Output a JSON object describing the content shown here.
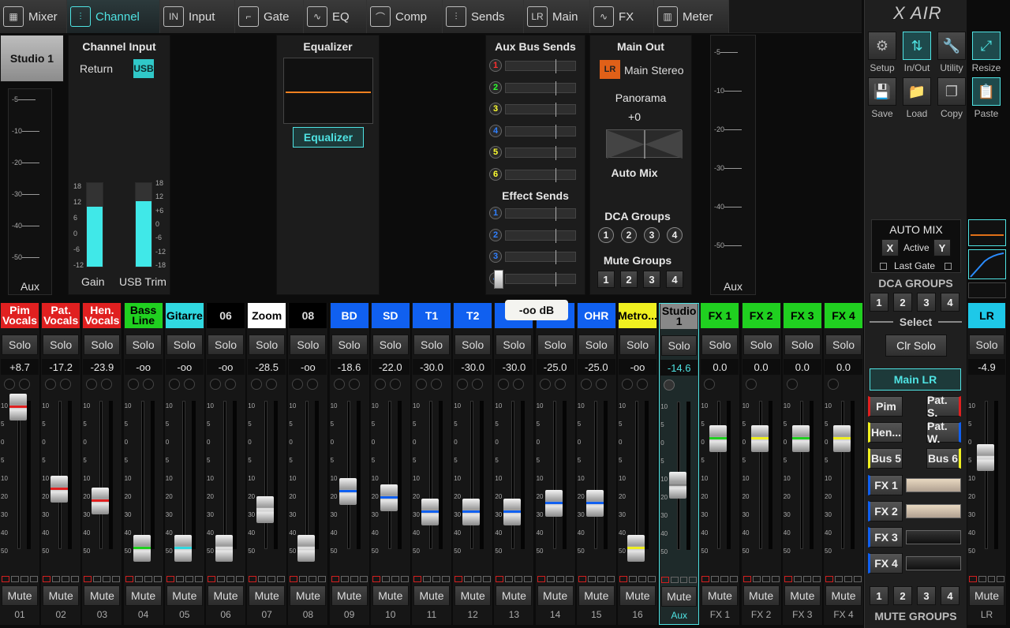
{
  "tabs": [
    {
      "label": "Mixer",
      "icon": "mixer-icon",
      "glyph": "▦",
      "active": false,
      "w": 85
    },
    {
      "label": "Channel",
      "icon": "channel-icon",
      "glyph": "⫶",
      "active": true,
      "w": 118
    },
    {
      "label": "Input",
      "icon": "input-icon",
      "glyph": "IN",
      "active": false,
      "w": 95
    },
    {
      "label": "Gate",
      "icon": "gate-icon",
      "glyph": "⌐",
      "active": false,
      "w": 87
    },
    {
      "label": "EQ",
      "icon": "eq-icon",
      "glyph": "∿",
      "active": false,
      "w": 80
    },
    {
      "label": "Comp",
      "icon": "comp-icon",
      "glyph": "⌒",
      "active": false,
      "w": 96
    },
    {
      "label": "Sends",
      "icon": "sends-icon",
      "glyph": "⫶",
      "active": false,
      "w": 103
    },
    {
      "label": "Main",
      "icon": "main-icon",
      "glyph": "LR",
      "active": false,
      "w": 84
    },
    {
      "label": "FX",
      "icon": "fx-icon",
      "glyph": "∿",
      "active": false,
      "w": 81
    },
    {
      "label": "Meter",
      "icon": "meter-icon",
      "glyph": "▥",
      "active": false,
      "w": 95
    }
  ],
  "channel_name": "Studio 1",
  "aux_meter_label": "Aux",
  "channel_input": {
    "title": "Channel Input",
    "return_label": "Return",
    "usb_label": "USB",
    "gain_label": "Gain",
    "usb_trim_label": "USB Trim",
    "gain_scale": [
      "18",
      "12",
      "6",
      "0",
      "-6",
      "-12"
    ],
    "trim_scale": [
      "18",
      "12",
      "+6",
      "0",
      "-6",
      "-12",
      "-18"
    ],
    "gain_level": 0.72,
    "trim_level": 0.78
  },
  "left_scale": [
    "-5",
    "-10",
    "-20",
    "-30",
    "-40",
    "-50"
  ],
  "equalizer": {
    "title": "Equalizer",
    "button": "Equalizer"
  },
  "aux_sends": {
    "title": "Aux Bus Sends",
    "buses": [
      {
        "n": "1",
        "color": "#ff3030"
      },
      {
        "n": "2",
        "color": "#30ff30"
      },
      {
        "n": "3",
        "color": "#ffff30"
      },
      {
        "n": "4",
        "color": "#3080ff"
      },
      {
        "n": "5",
        "color": "#ffff30"
      },
      {
        "n": "6",
        "color": "#ffff30"
      }
    ],
    "effect_title": "Effect Sends",
    "effects": [
      {
        "n": "1",
        "color": "#3080ff"
      },
      {
        "n": "2",
        "color": "#3080ff"
      },
      {
        "n": "3",
        "color": "#3080ff"
      },
      {
        "n": "4",
        "color": "#3080ff"
      }
    ],
    "tooltip": "-oo dB"
  },
  "main_out": {
    "title": "Main Out",
    "lr_badge": "LR",
    "lr_label": "Main Stereo",
    "panorama": "Panorama",
    "pan_value": "+0",
    "auto_mix": "Auto Mix",
    "dca_title": "DCA Groups",
    "dca": [
      "1",
      "2",
      "3",
      "4"
    ],
    "mute_title": "Mute Groups",
    "mutes": [
      "1",
      "2",
      "3",
      "4"
    ]
  },
  "right_meter": {
    "label": "Aux",
    "scale": [
      "-5",
      "-10",
      "-20",
      "-30",
      "-40",
      "-50"
    ]
  },
  "fader_scale": [
    "10",
    "5",
    "0",
    "5",
    "10",
    "20",
    "30",
    "40",
    "50"
  ],
  "strips": [
    {
      "name": "Pim Vocals",
      "bg": "#e02020",
      "fg": "#fff",
      "val": "+8.7",
      "num": "01",
      "stripe": "#e02020",
      "fader_db": 8.7,
      "knobs": 2,
      "solo": "Solo",
      "mute": "Mute"
    },
    {
      "name": "Pat. Vocals",
      "bg": "#e02020",
      "fg": "#fff",
      "val": "-17.2",
      "num": "02",
      "stripe": "#e02020",
      "fader_db": -17.2,
      "knobs": 2,
      "solo": "Solo",
      "mute": "Mute"
    },
    {
      "name": "Hen. Vocals",
      "bg": "#e02020",
      "fg": "#fff",
      "val": "-23.9",
      "num": "03",
      "stripe": "#e02020",
      "fader_db": -23.9,
      "knobs": 2,
      "solo": "Solo",
      "mute": "Mute"
    },
    {
      "name": "Bass Line",
      "bg": "#20d020",
      "fg": "#000",
      "val": "-oo",
      "num": "04",
      "stripe": "#20d020",
      "fader_db": -60,
      "knobs": 2,
      "solo": "Solo",
      "mute": "Mute"
    },
    {
      "name": "Gitarre",
      "bg": "#30d8e0",
      "fg": "#000",
      "val": "-oo",
      "num": "05",
      "stripe": "#30d8e0",
      "fader_db": -60,
      "knobs": 2,
      "solo": "Solo",
      "mute": "Mute"
    },
    {
      "name": "06",
      "bg": "#000",
      "fg": "#ddd",
      "val": "-oo",
      "num": "06",
      "stripe": "#ddd",
      "fader_db": -60,
      "knobs": 2,
      "solo": "Solo",
      "mute": "Mute"
    },
    {
      "name": "Zoom",
      "bg": "#fff",
      "fg": "#000",
      "val": "-28.5",
      "num": "07",
      "stripe": "#ddd",
      "fader_db": -28.5,
      "knobs": 2,
      "solo": "Solo",
      "mute": "Mute"
    },
    {
      "name": "08",
      "bg": "#000",
      "fg": "#ddd",
      "val": "-oo",
      "num": "08",
      "stripe": "#ddd",
      "fader_db": -60,
      "knobs": 2,
      "solo": "Solo",
      "mute": "Mute"
    },
    {
      "name": "BD",
      "bg": "#1060f0",
      "fg": "#fff",
      "val": "-18.6",
      "num": "09",
      "stripe": "#1060f0",
      "fader_db": -18.6,
      "knobs": 2,
      "solo": "Solo",
      "mute": "Mute"
    },
    {
      "name": "SD",
      "bg": "#1060f0",
      "fg": "#fff",
      "val": "-22.0",
      "num": "10",
      "stripe": "#1060f0",
      "fader_db": -22,
      "knobs": 2,
      "solo": "Solo",
      "mute": "Mute"
    },
    {
      "name": "T1",
      "bg": "#1060f0",
      "fg": "#fff",
      "val": "-30.0",
      "num": "11",
      "stripe": "#1060f0",
      "fader_db": -30,
      "knobs": 2,
      "solo": "Solo",
      "mute": "Mute"
    },
    {
      "name": "T2",
      "bg": "#1060f0",
      "fg": "#fff",
      "val": "-30.0",
      "num": "12",
      "stripe": "#1060f0",
      "fader_db": -30,
      "knobs": 2,
      "solo": "Solo",
      "mute": "Mute"
    },
    {
      "name": "",
      "bg": "#1060f0",
      "fg": "#fff",
      "val": "-30.0",
      "num": "13",
      "stripe": "#1060f0",
      "fader_db": -30,
      "knobs": 2,
      "solo": "Solo",
      "mute": "Mute"
    },
    {
      "name": "",
      "bg": "#1060f0",
      "fg": "#fff",
      "val": "-25.0",
      "num": "14",
      "stripe": "#1060f0",
      "fader_db": -25,
      "knobs": 2,
      "solo": "Solo",
      "mute": "Mute"
    },
    {
      "name": "OHR",
      "bg": "#1060f0",
      "fg": "#fff",
      "val": "-25.0",
      "num": "15",
      "stripe": "#1060f0",
      "fader_db": -25,
      "knobs": 2,
      "solo": "Solo",
      "mute": "Mute"
    },
    {
      "name": "Metro...",
      "bg": "#f0f020",
      "fg": "#000",
      "val": "-oo",
      "num": "16",
      "stripe": "#f0f020",
      "fader_db": -60,
      "knobs": 2,
      "solo": "Solo",
      "mute": "Mute"
    },
    {
      "name": "Studio 1",
      "bg": "#888",
      "fg": "#000",
      "val": "-14.6",
      "num": "Aux",
      "stripe": "#888",
      "fader_db": -14.6,
      "knobs": 1,
      "solo": "Solo",
      "mute": "Mute",
      "selected": true
    },
    {
      "name": "FX 1",
      "bg": "#20d020",
      "fg": "#000",
      "val": "0.0",
      "num": "FX 1",
      "stripe": "#20d020",
      "fader_db": 0,
      "knobs": 1,
      "solo": "Solo",
      "mute": "Mute"
    },
    {
      "name": "FX 2",
      "bg": "#20d020",
      "fg": "#000",
      "val": "0.0",
      "num": "FX 2",
      "stripe": "#f0f020",
      "fader_db": 0,
      "knobs": 1,
      "solo": "Solo",
      "mute": "Mute"
    },
    {
      "name": "FX 3",
      "bg": "#20d020",
      "fg": "#000",
      "val": "0.0",
      "num": "FX 3",
      "stripe": "#20d020",
      "fader_db": 0,
      "knobs": 1,
      "solo": "Solo",
      "mute": "Mute"
    },
    {
      "name": "FX 4",
      "bg": "#20d020",
      "fg": "#000",
      "val": "0.0",
      "num": "FX 4",
      "stripe": "#f0f020",
      "fader_db": 0,
      "knobs": 1,
      "solo": "Solo",
      "mute": "Mute"
    }
  ],
  "lr_strip": {
    "name": "LR",
    "val": "-4.9",
    "num": "LR",
    "solo": "Solo",
    "mute": "Mute",
    "fader_db": -4.9
  },
  "right_panel": {
    "brand": "X AIR",
    "tools": [
      {
        "label": "Setup",
        "icon": "gear-icon",
        "glyph": "⚙",
        "on": false
      },
      {
        "label": "In/Out",
        "icon": "inout-icon",
        "glyph": "⇅",
        "on": true
      },
      {
        "label": "Utility",
        "icon": "wrench-icon",
        "glyph": "🔧",
        "on": false
      },
      {
        "label": "Resize",
        "icon": "resize-icon",
        "glyph": "⤢",
        "on": true
      },
      {
        "label": "Save",
        "icon": "save-icon",
        "glyph": "💾",
        "on": false
      },
      {
        "label": "Load",
        "icon": "folder-icon",
        "glyph": "📁",
        "on": false
      },
      {
        "label": "Copy",
        "icon": "copy-icon",
        "glyph": "❐",
        "on": false
      },
      {
        "label": "Paste",
        "icon": "paste-icon",
        "glyph": "📋",
        "on": true
      }
    ],
    "automix": {
      "title": "AUTO MIX",
      "x": "X",
      "active": "Active",
      "y": "Y",
      "last_gate": "Last Gate"
    },
    "dca_title": "DCA GROUPS",
    "dca": [
      "1",
      "2",
      "3",
      "4"
    ],
    "select": "Select",
    "clr_solo": "Clr Solo",
    "main_lr": "Main LR",
    "buses": [
      {
        "label": "Pim",
        "color": "#e02020"
      },
      {
        "label": "Pat. S.",
        "color": "#e02020"
      },
      {
        "label": "Hen...",
        "color": "#f0f020"
      },
      {
        "label": "Pat. W.",
        "color": "#1060f0"
      },
      {
        "label": "Bus 5",
        "color": "#f0f020"
      },
      {
        "label": "Bus 6",
        "color": "#f0f020"
      }
    ],
    "fx": [
      {
        "label": "FX 1",
        "color": "#1060f0"
      },
      {
        "label": "FX 2",
        "color": "#1060f0"
      },
      {
        "label": "FX 3",
        "color": "#1060f0"
      },
      {
        "label": "FX 4",
        "color": "#1060f0"
      }
    ],
    "mute_groups": [
      "1",
      "2",
      "3",
      "4"
    ],
    "mute_title": "MUTE GROUPS"
  }
}
